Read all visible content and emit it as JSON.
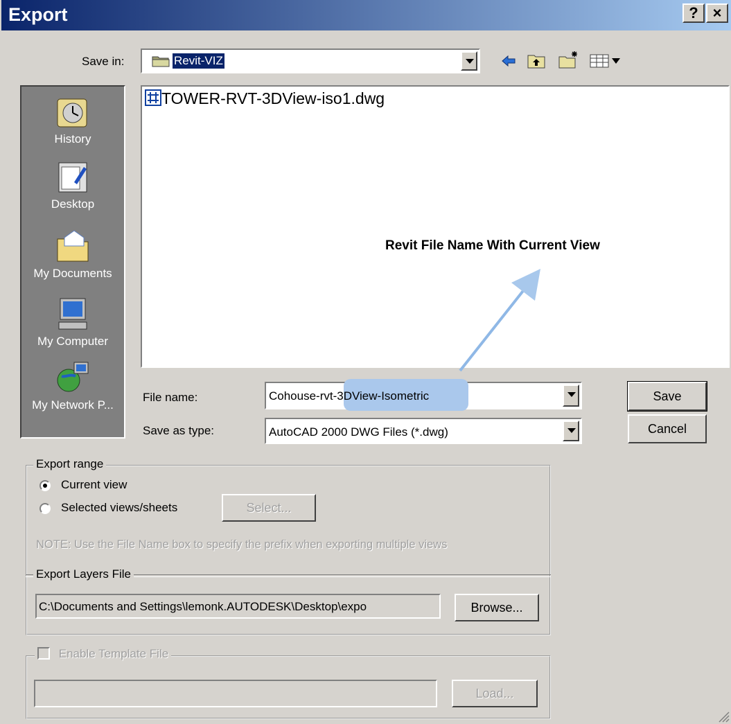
{
  "window": {
    "title": "Export",
    "help_label": "?",
    "close_label": "×"
  },
  "save_in": {
    "label": "Save in:",
    "value": "Revit-VIZ"
  },
  "places": [
    {
      "label": "History",
      "icon": "history-icon"
    },
    {
      "label": "Desktop",
      "icon": "desktop-icon"
    },
    {
      "label": "My Documents",
      "icon": "my-documents-icon"
    },
    {
      "label": "My Computer",
      "icon": "my-computer-icon"
    },
    {
      "label": "My Network P...",
      "icon": "my-network-places-icon"
    }
  ],
  "file_list": [
    {
      "name": "TOWER-RVT-3DView-iso1.dwg",
      "icon": "dwg-file-icon"
    }
  ],
  "file_name": {
    "label": "File name:",
    "value": "Cohouse-rvt-3DView-Isometric"
  },
  "save_as_type": {
    "label": "Save as type:",
    "value": "AutoCAD 2000 DWG Files (*.dwg)"
  },
  "buttons": {
    "save": "Save",
    "cancel": "Cancel",
    "select": "Select...",
    "browse": "Browse...",
    "load": "Load..."
  },
  "export_range": {
    "title": "Export range",
    "current_view": "Current view",
    "selected_views": "Selected views/sheets",
    "selected": "current_view",
    "note": "NOTE: Use the File Name box to specify the prefix when exporting multiple views"
  },
  "export_layers": {
    "title": "Export Layers File",
    "path": "C:\\Documents and Settings\\lemonk.AUTODESK\\Desktop\\expo"
  },
  "template": {
    "title": "Enable Template File",
    "checked": false,
    "path": ""
  },
  "annotation": {
    "text": "Revit File Name With Current View"
  },
  "colors": {
    "title_start": "#0a246a",
    "title_end": "#a6caf0",
    "highlight": "#0a246a",
    "annotation_arrow": "#8fb8e6"
  }
}
